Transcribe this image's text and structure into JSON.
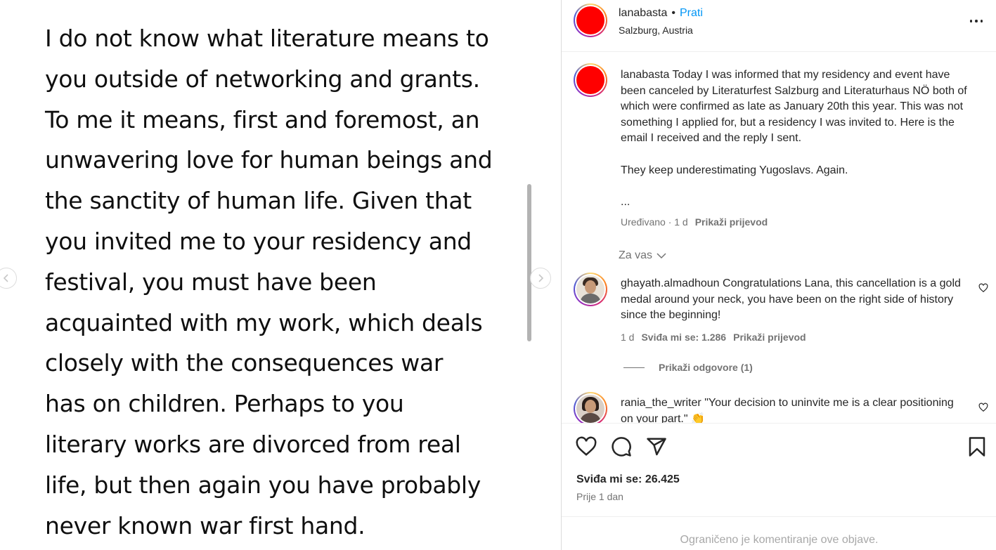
{
  "media": {
    "text": "I do not know what literature means to\nyou outside of networking and grants.\nTo me it means, first and foremost, an\nunwavering love for human beings and\nthe sanctity of human life. Given that\nyou invited me to your residency and\nfestival, you must have been\nacquainted with my work, which deals\nclosely with the consequences war\nhas on children. Perhaps to you\nliterary works are divorced from real\nlife, but then again you have probably\nnever known war first hand."
  },
  "header": {
    "username": "lanabasta",
    "dot": "•",
    "follow_label": "Prati",
    "location": "Salzburg, Austria"
  },
  "caption": {
    "username": "lanabasta",
    "text": "Today I was informed that my residency and event have been canceled by Literaturfest Salzburg and Literaturhaus NÖ both of which were confirmed as late as January 20th this year. This was not something I applied for, but a residency I was invited to. Here is the email I received and the reply I sent.\n\nThey keep underestimating Yugoslavs. Again.\n\n...",
    "meta_edited": "Uređivano · 1 d",
    "meta_translate": "Prikaži prijevod"
  },
  "for_you_label": "Za vas",
  "comments": [
    {
      "username": "ghayath.almadhoun",
      "text": "Congratulations Lana, this cancellation is a gold medal around your neck, you have been on the right side of history since the beginning!",
      "time": "1 d",
      "likes": "Sviđa mi se: 1.286",
      "translate": "Prikaži prijevod",
      "replies": "Prikaži odgovore (1)"
    },
    {
      "username": "rania_the_writer",
      "text": "\"Your decision to uninvite me is a clear positioning on your part.\" 👏"
    }
  ],
  "actions": {
    "likes": "Sviđa mi se: 26.425",
    "ago": "Prije 1 dan"
  },
  "comments_limited": "Ograničeno je komentiranje ove objave.",
  "colors": {
    "accent": "#0095f6",
    "avatar_red": "#ff0000",
    "secondary_text": "#737373"
  }
}
